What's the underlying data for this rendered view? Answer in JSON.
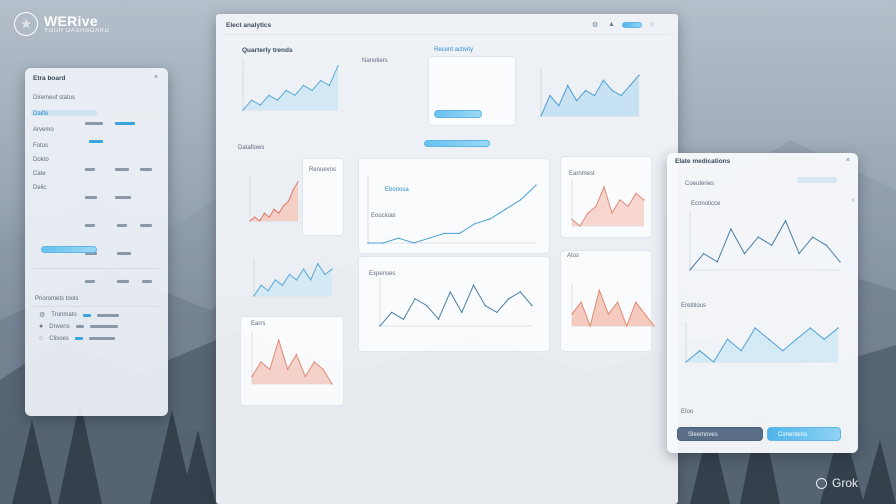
{
  "brand": {
    "name": "WERive",
    "tagline": "YOUR DASHBOARD"
  },
  "main": {
    "header_title": "Elect analytics",
    "cards": {
      "top_left_title": "Quarterly trends",
      "top_middle_label": "Nanotiers",
      "top_right_title": "Recent activity",
      "section_title": "Dataflows",
      "legend_label": "Renuevos",
      "big_chart_title": "Ebonosa",
      "big_chart_subtitle": "Eoucioas",
      "side_chart_title": "Earnmest",
      "bottom_chart_title": "Expenses",
      "bottom_right_title": "Atos",
      "bottom_left_title": "Earrs"
    }
  },
  "left": {
    "title": "Etra board",
    "subtitle": "Diremeuf status",
    "rows": [
      "Dailfe",
      "Arvemo",
      "Fotos",
      "Dokto",
      "Cate",
      "Delic"
    ],
    "footer_title": "Prioromets tools",
    "footer_rows": [
      "Trunmato",
      "Dnvens",
      "Clisoes"
    ]
  },
  "right": {
    "title": "Elate medications",
    "header_label": "Coeuteries",
    "section_label": "Econoticce",
    "section_label_2": "Eretitious",
    "footer_label": "Etoo",
    "btn_dark": "Sleemoves",
    "btn_light": "Conentens"
  },
  "watermark": "Grok",
  "icons": [
    "logo-icon",
    "gear-icon",
    "bell-icon",
    "user-icon",
    "close-icon",
    "chevron-icon",
    "grok-icon"
  ],
  "colors": {
    "accent": "#3aa4df",
    "chart_red": "#e8a08e",
    "chart_blue": "#9fd1ec",
    "panel": "#eef2f7"
  },
  "chart_data": [
    {
      "type": "area",
      "title": "",
      "series": [
        {
          "values": [
            3,
            5,
            4,
            6,
            5,
            7,
            6,
            8,
            7,
            9,
            8,
            12
          ]
        }
      ]
    },
    {
      "type": "area",
      "title": "",
      "series": [
        {
          "values": [
            4,
            8,
            6,
            10,
            7,
            9,
            8,
            11,
            9,
            8,
            10,
            12
          ]
        }
      ]
    },
    {
      "type": "area",
      "title": "",
      "series": [
        {
          "values": [
            2,
            3,
            2,
            4,
            3,
            5,
            4,
            6,
            7,
            10,
            12
          ]
        }
      ]
    },
    {
      "type": "line",
      "title": "",
      "series": [
        {
          "values": [
            2,
            2,
            3,
            2,
            3,
            4,
            4,
            6,
            7,
            9,
            11,
            14
          ]
        }
      ]
    },
    {
      "type": "area",
      "title": "",
      "series": [
        {
          "values": [
            7,
            6,
            8,
            9,
            12,
            8,
            10,
            9,
            11,
            10
          ]
        }
      ]
    },
    {
      "type": "area",
      "title": "",
      "series": [
        {
          "values": [
            3,
            5,
            4,
            6,
            5,
            7,
            6,
            8,
            6,
            9,
            7,
            8
          ]
        }
      ]
    },
    {
      "type": "line",
      "title": "",
      "series": [
        {
          "values": [
            4,
            6,
            5,
            8,
            7,
            5,
            9,
            6,
            10,
            7,
            6,
            8,
            9,
            7
          ]
        }
      ]
    },
    {
      "type": "area",
      "title": "",
      "series": [
        {
          "values": [
            5,
            6,
            4,
            7,
            5,
            6,
            4,
            6,
            5,
            4
          ]
        }
      ]
    },
    {
      "type": "area",
      "title": "",
      "series": [
        {
          "values": [
            4,
            6,
            5,
            9,
            5,
            7,
            4,
            6,
            5,
            3
          ]
        }
      ]
    },
    {
      "type": "line",
      "title": "",
      "series": [
        {
          "values": [
            4,
            6,
            5,
            9,
            6,
            8,
            7,
            10,
            6,
            8,
            7,
            5
          ]
        }
      ]
    },
    {
      "type": "area",
      "title": "",
      "series": [
        {
          "values": [
            3,
            4,
            3,
            5,
            4,
            6,
            5,
            4,
            5,
            6,
            5,
            6
          ]
        }
      ]
    }
  ]
}
